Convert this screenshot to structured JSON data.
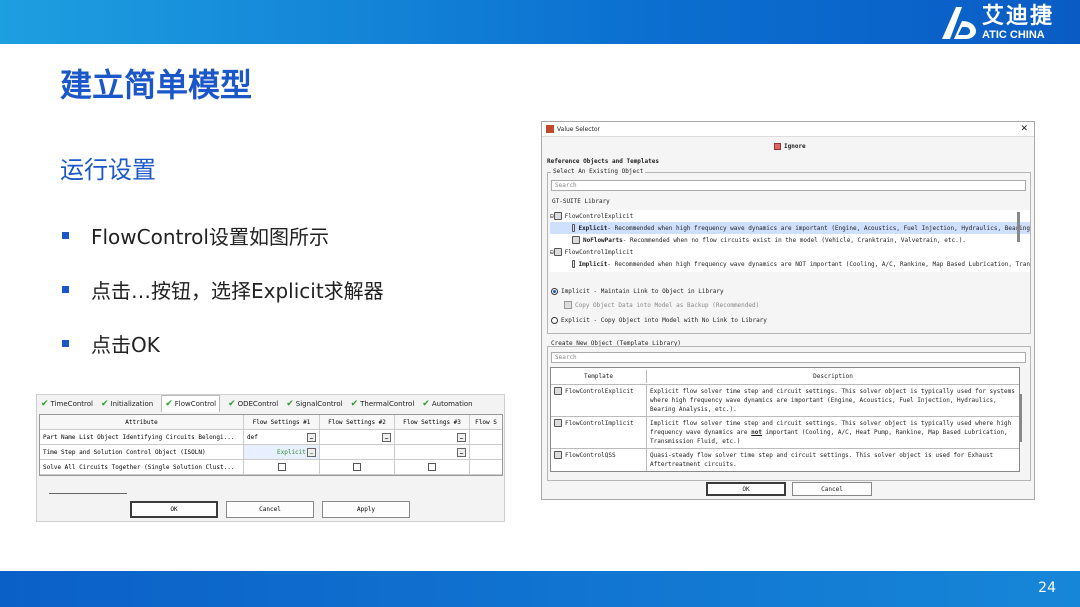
{
  "slide": {
    "title": "建立简单模型",
    "subtitle": "运行设置",
    "bullets": [
      "FlowControl设置如图所示",
      "点击…按钮，选择Explicit求解器",
      "点击OK"
    ],
    "page_number": "24",
    "logo_cn": "艾迪捷",
    "logo_en": "ATIC CHINA",
    "accent": "#1b57c8"
  },
  "left_panel": {
    "tabs": [
      "TimeControl",
      "Initialization",
      "FlowControl",
      "ODEControl",
      "SignalControl",
      "ThermalControl",
      "Automation"
    ],
    "active_tab": "FlowControl",
    "columns": [
      "Attribute",
      "Flow Settings #1",
      "Flow Settings #2",
      "Flow Settings #3",
      "Flow S"
    ],
    "rows": [
      {
        "attribute": "Part Name List Object Identifying Circuits Belongi...",
        "v1": "def"
      },
      {
        "attribute": "Time Step and Solution Control Object (ISOLN)",
        "v1": "Explicit"
      },
      {
        "attribute": "Solve All Circuits Together (Single Solution Clust..."
      }
    ],
    "buttons": {
      "ok": "OK",
      "cancel": "Cancel",
      "apply": "Apply"
    }
  },
  "dialog": {
    "title": "Value Selector",
    "ignore": "Ignore",
    "ref_header": "Reference Objects and Templates",
    "existing_label": "Select An Existing Object",
    "search_placeholder": "Search",
    "library_label": "GT-SUITE Library",
    "tree": [
      {
        "name": "FlowControlExplicit",
        "level": 0
      },
      {
        "name": "Explicit",
        "desc": " - Recommended when high frequency wave dynamics are important (Engine, Acoustics, Fuel Injection, Hydraulics, Bearing",
        "level": 1
      },
      {
        "name": "NoFlowParts",
        "desc": " - Recommended when no flow circuits exist in the model (Vehicle, Cranktrain, Valvetrain, etc.).",
        "level": 1
      },
      {
        "name": "FlowControlImplicit",
        "level": 0
      },
      {
        "name": "Implicit",
        "desc": " - Recommended when high frequency wave dynamics are NOT important (Cooling, A/C, Rankine, Map Based Lubrication, Tran",
        "level": 1
      }
    ],
    "radio_implicit": "Implicit - Maintain Link to Object in Library",
    "copy_checkbox": "Copy Object Data into Model as Backup (Recommended)",
    "radio_explicit": "Explicit - Copy Object into Model with No Link to Library",
    "create_label": "Create New Object (Template Library)",
    "table_headers": [
      "Template",
      "Description"
    ],
    "templates": [
      {
        "name": "FlowControlExplicit",
        "desc": "Explicit flow solver time step and circuit settings. This solver object is typically used for systems where high frequency wave dynamics are important (Engine, Acoustics, Fuel Injection, Hydraulics, Bearing Analysis, etc.)."
      },
      {
        "name": "FlowControlImplicit",
        "desc_a": "Implicit flow solver time step and circuit settings. This solver object is typically used where high frequency wave dynamics are ",
        "desc_b": "not",
        "desc_c": " important (Cooling, A/C, Heat Pump, Rankine, Map Based Lubrication, Transmission Fluid, etc.)"
      },
      {
        "name": "FlowControlQSS",
        "desc": "Quasi-steady flow solver time step and circuit settings. This solver object is used for Exhaust Aftertreatment circuits."
      }
    ],
    "buttons": {
      "ok": "OK",
      "cancel": "Cancel"
    }
  }
}
